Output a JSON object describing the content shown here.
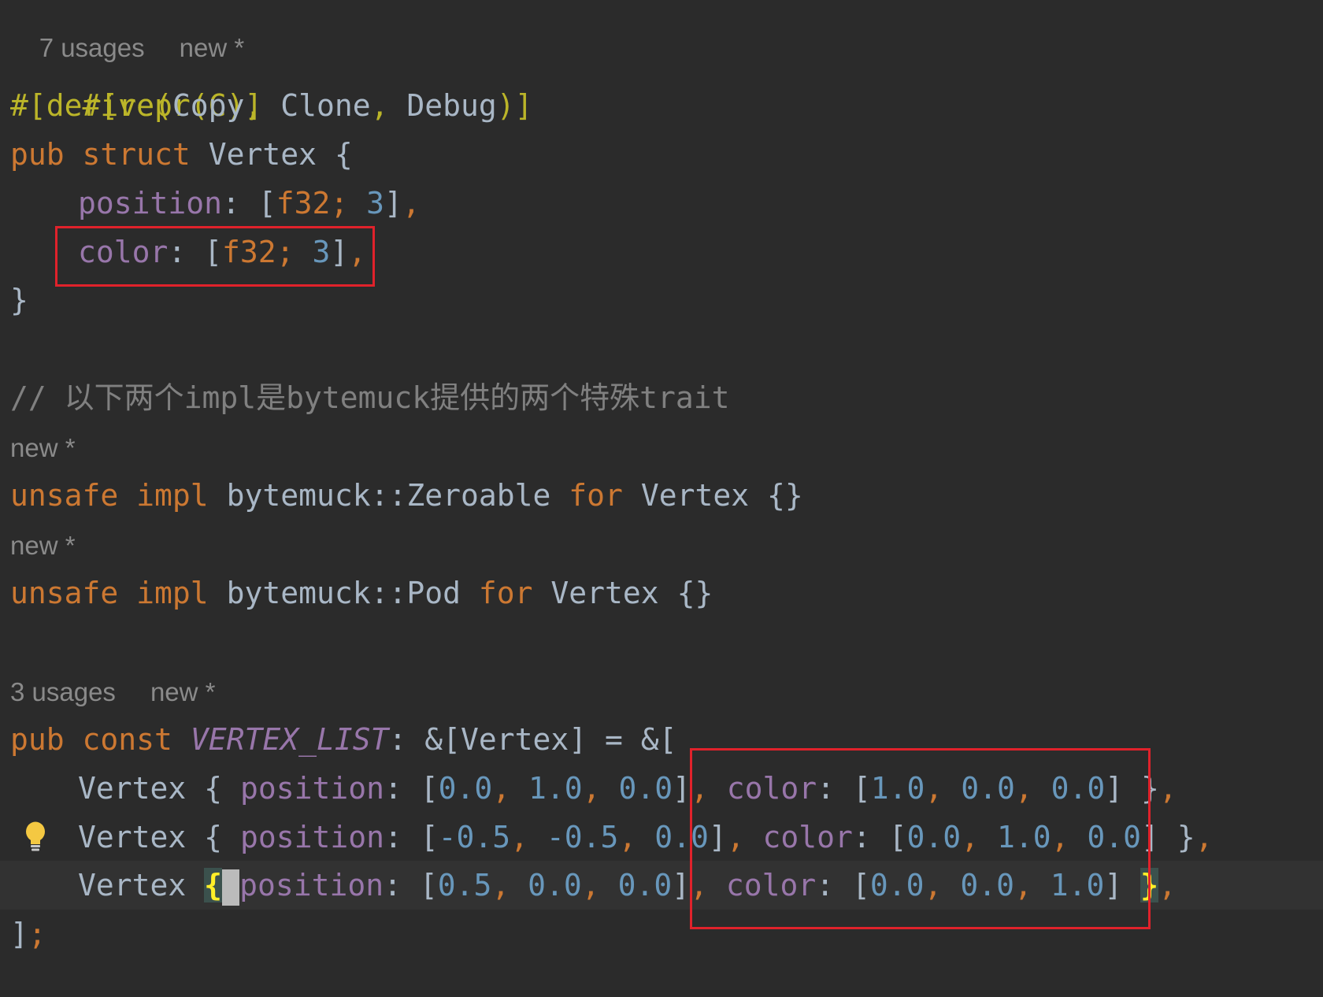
{
  "editor": {
    "hints": {
      "struct_usages": "7 usages",
      "struct_new": "new *",
      "zeroable_new": "new *",
      "pod_new": "new *",
      "list_usages": "3 usages",
      "list_new": "new *"
    },
    "code": {
      "attr_repr": "#[repr(C)]",
      "attr_derive_open": "#[derive(",
      "derive_copy": "Copy",
      "comma1": ", ",
      "derive_clone": "Clone",
      "comma2": ", ",
      "derive_debug": "Debug",
      "attr_derive_close": ")]",
      "kw_pub": "pub",
      "kw_struct": "struct",
      "struct_name": "Vertex",
      "open_brace": "{",
      "field_position": "position",
      "field_color": "color",
      "colon": ": ",
      "type_open": "[",
      "type_f32": "f32",
      "type_sep": "; ",
      "type_len": "3",
      "type_close": "]",
      "trail_comma": ",",
      "close_brace": "}",
      "comment": "// 以下两个impl是bytemuck提供的两个特殊trait",
      "kw_unsafe": "unsafe",
      "kw_impl": "impl",
      "zeroable_path": "bytemuck::Zeroable",
      "pod_path": "bytemuck::Pod",
      "kw_for": "for",
      "empty_body": "{}",
      "kw_const": "const",
      "const_name": "VERTEX_LIST",
      "const_type": ": &[Vertex] = &[",
      "list_close": "]",
      "list_semicolon": ";"
    },
    "vertices": [
      {
        "position": [
          "0.0",
          "1.0",
          "0.0"
        ],
        "color": [
          "1.0",
          "0.0",
          "0.0"
        ]
      },
      {
        "position": [
          "-0.5",
          "-0.5",
          "0.0"
        ],
        "color": [
          "0.0",
          "1.0",
          "0.0"
        ]
      },
      {
        "position": [
          "0.5",
          "0.0",
          "0.0"
        ],
        "color": [
          "0.0",
          "0.0",
          "1.0"
        ]
      }
    ],
    "punct": {
      "comma_sp": ", ",
      "sp": " ",
      "brace_close_sp": " }",
      "struct_init": "Vertex",
      "brace_open": "{",
      "brace_close": "}"
    }
  },
  "colors": {
    "background": "#2b2b2b",
    "keyword": "#cc7832",
    "attribute": "#bbb529",
    "field": "#9876aa",
    "number": "#6897bb",
    "comment": "#808080",
    "annotation_box": "#e0222b"
  },
  "icons": {
    "intention_bulb": "lightbulb-icon"
  }
}
